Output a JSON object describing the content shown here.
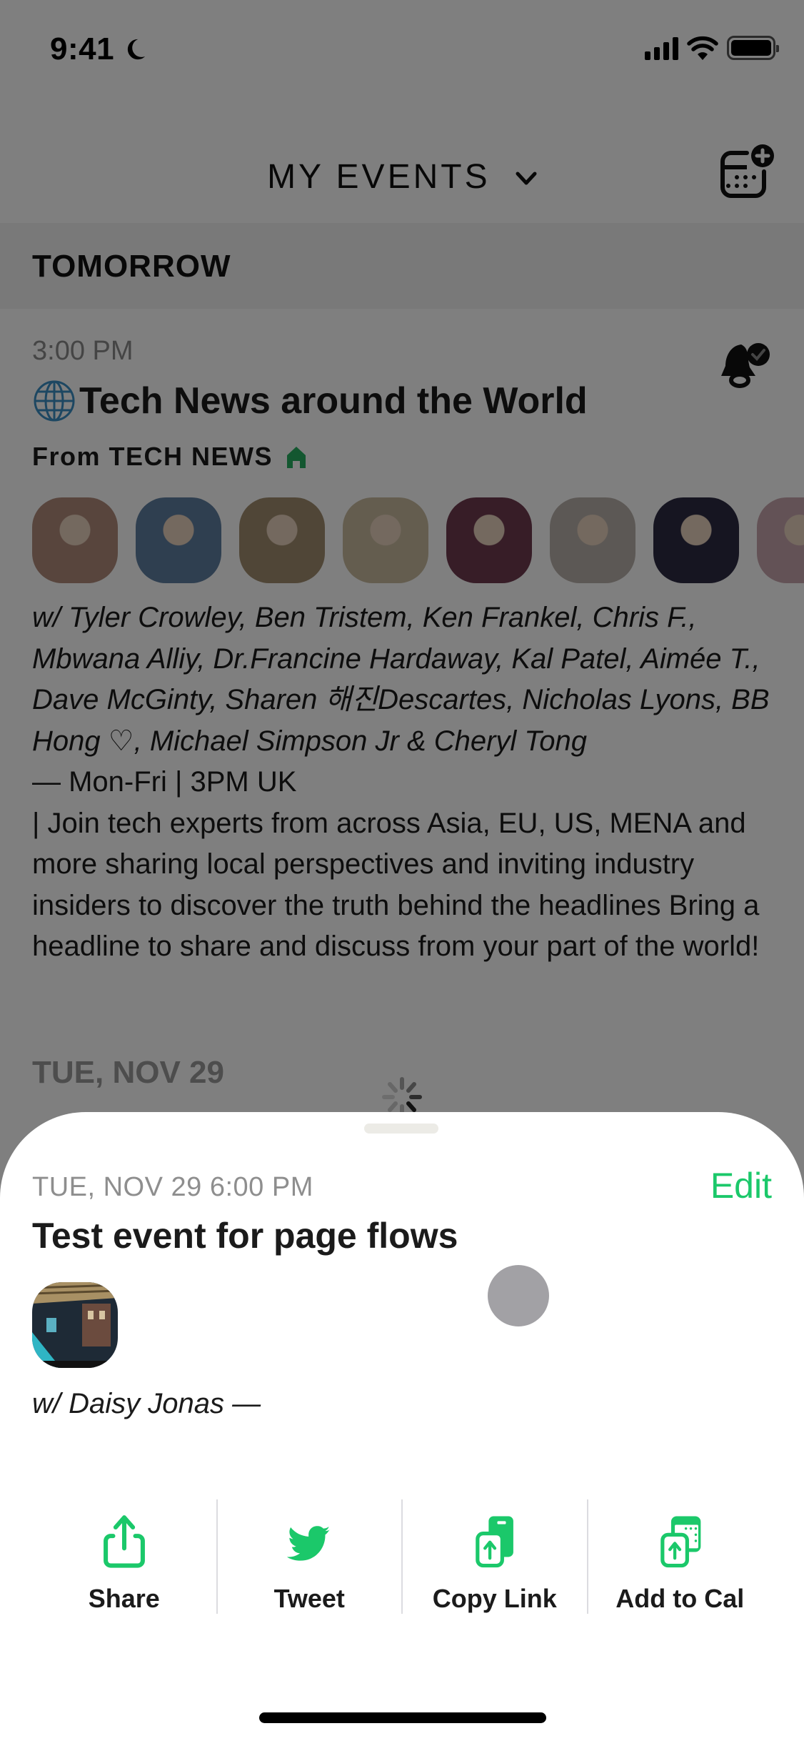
{
  "status_bar": {
    "time": "9:41",
    "focus_icon": "moon-icon",
    "signal_icon": "cellular-signal-icon",
    "wifi_icon": "wifi-icon",
    "battery_icon": "battery-icon"
  },
  "header": {
    "title": "MY EVENTS",
    "dropdown_icon": "chevron-down-icon",
    "action_icon": "calendar-add-icon"
  },
  "section": {
    "label": "TOMORROW"
  },
  "event": {
    "time": "3:00 PM",
    "title_emoji": "globe-icon",
    "title": "Tech News around the World",
    "club_prefix": "From",
    "club_name": "TECH NEWS",
    "club_icon": "house-icon",
    "notify_icon": "bell-check-icon",
    "speakers_line": "w/ Tyler Crowley, Ben Tristem, Ken Frankel, Chris F., Mbwana Alliy, Dr.Francine Hardaway, Kal Patel, Aimée T., Dave McGinty, Sharen 해진Descartes, Nicholas Lyons, BB Hong ♡, Michael Simpson Jr & Cheryl Tong",
    "schedule": " — Mon-Fri | 3PM UK",
    "description": " | Join tech experts from across Asia, EU, US, MENA and more sharing local perspectives and inviting industry insiders to discover the truth behind the headlines Bring a headline to share and discuss from your part of the world!",
    "avatar_count_visible": 8,
    "avatar_colors": [
      "#b08a7a",
      "#5f7ea0",
      "#a18d6e",
      "#c8bb9f",
      "#6e3a4f",
      "#b9b1aa",
      "#2c2b43",
      "#c7a5ad"
    ]
  },
  "next_section": {
    "label": "TUE, NOV 29"
  },
  "sheet": {
    "date": "TUE, NOV 29 6:00 PM",
    "edit_label": "Edit",
    "title": "Test event for page flows",
    "with_line": "w/ Daisy Jonas —",
    "actions": [
      {
        "label": "Share",
        "icon": "share-icon"
      },
      {
        "label": "Tweet",
        "icon": "twitter-icon"
      },
      {
        "label": "Copy Link",
        "icon": "copy-link-icon"
      },
      {
        "label": "Add to Cal",
        "icon": "add-to-calendar-icon"
      }
    ]
  },
  "colors": {
    "accent_green": "#1bc86a",
    "club_house_green": "#27ae60",
    "text_dark": "#1b1b1b",
    "text_muted": "#8e8e8e"
  }
}
